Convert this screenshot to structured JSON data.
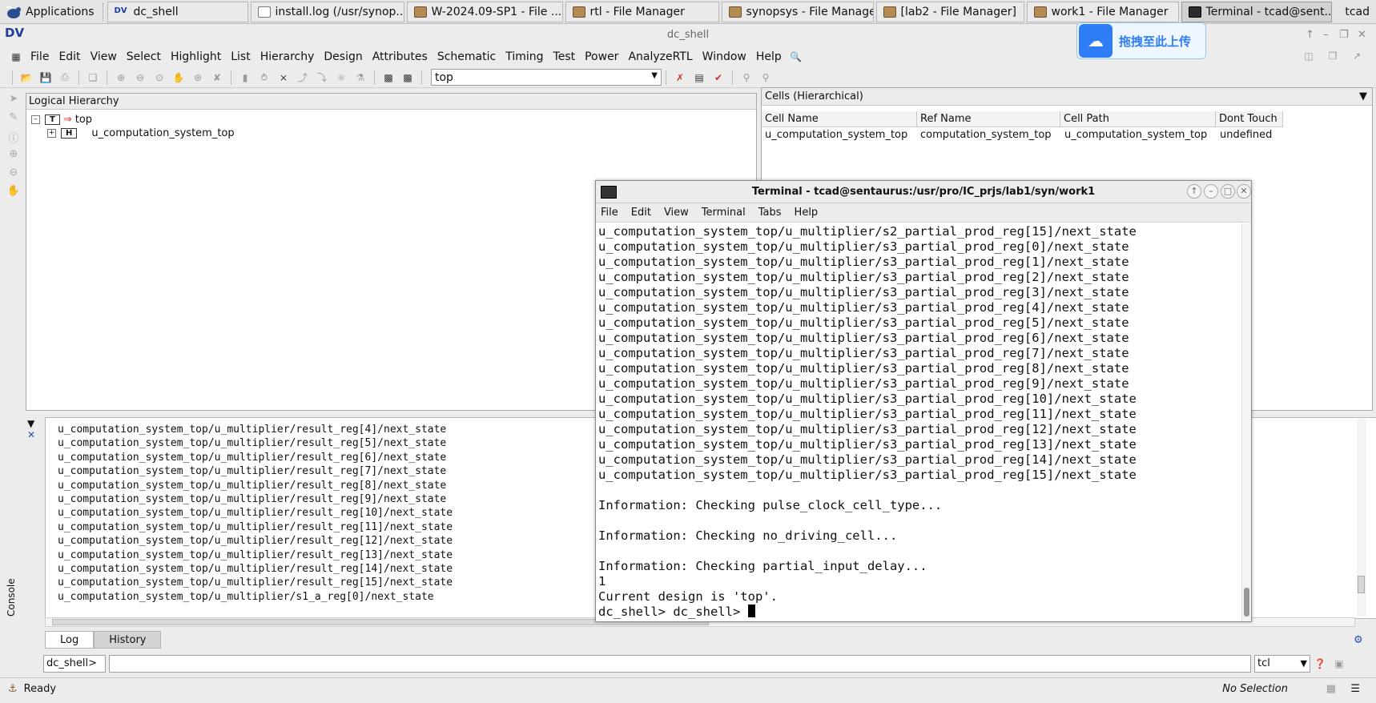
{
  "taskbar": {
    "applications_label": "Applications",
    "tasks": [
      {
        "label": "dc_shell",
        "icon": "dv-icon"
      },
      {
        "label": "install.log (/usr/synop...",
        "icon": "text-editor-icon"
      },
      {
        "label": "W-2024.09-SP1 - File ...",
        "icon": "folder-icon"
      },
      {
        "label": "rtl - File Manager",
        "icon": "folder-icon"
      },
      {
        "label": "synopsys - File Manager",
        "icon": "folder-icon"
      },
      {
        "label": "[lab2 - File Manager]",
        "icon": "folder-icon"
      },
      {
        "label": "work1 - File Manager",
        "icon": "folder-icon"
      },
      {
        "label": "Terminal - tcad@sent...",
        "icon": "terminal-icon"
      }
    ],
    "user": "tcad"
  },
  "app": {
    "logo": "DV",
    "title": "dc_shell"
  },
  "menu": [
    {
      "label": "File",
      "u": "F"
    },
    {
      "label": "Edit",
      "u": "E"
    },
    {
      "label": "View",
      "u": "V"
    },
    {
      "label": "Select",
      "u": "S"
    },
    {
      "label": "Highlight",
      "u": "H"
    },
    {
      "label": "List",
      "u": "L"
    },
    {
      "label": "Hierarchy",
      "u": "H"
    },
    {
      "label": "Design",
      "u": "D"
    },
    {
      "label": "Attributes",
      "u": "A"
    },
    {
      "label": "Schematic",
      "u": "S"
    },
    {
      "label": "Timing",
      "u": "T"
    },
    {
      "label": "Test",
      "u": "T"
    },
    {
      "label": "Power",
      "u": "P"
    },
    {
      "label": "AnalyzeRTL",
      "u": ""
    },
    {
      "label": "Window",
      "u": "W"
    },
    {
      "label": "Help",
      "u": "H"
    }
  ],
  "toolbar": {
    "design_select_value": "top"
  },
  "hierarchy": {
    "title": "Logical Hierarchy",
    "root": {
      "tag": "T",
      "label": "top"
    },
    "child": {
      "tag": "H",
      "label": "u_computation_system_top"
    }
  },
  "cells": {
    "title": "Cells (Hierarchical)",
    "columns": [
      "Cell Name",
      "Ref Name",
      "Cell Path",
      "Dont Touch"
    ],
    "rows": [
      [
        "u_computation_system_top",
        "computation_system_top",
        "u_computation_system_top",
        "undefined"
      ]
    ]
  },
  "console": {
    "log_lines": [
      "u_computation_system_top/u_multiplier/result_reg[4]/next_state",
      "u_computation_system_top/u_multiplier/result_reg[5]/next_state",
      "u_computation_system_top/u_multiplier/result_reg[6]/next_state",
      "u_computation_system_top/u_multiplier/result_reg[7]/next_state",
      "u_computation_system_top/u_multiplier/result_reg[8]/next_state",
      "u_computation_system_top/u_multiplier/result_reg[9]/next_state",
      "u_computation_system_top/u_multiplier/result_reg[10]/next_state",
      "u_computation_system_top/u_multiplier/result_reg[11]/next_state",
      "u_computation_system_top/u_multiplier/result_reg[12]/next_state",
      "u_computation_system_top/u_multiplier/result_reg[13]/next_state",
      "u_computation_system_top/u_multiplier/result_reg[14]/next_state",
      "u_computation_system_top/u_multiplier/result_reg[15]/next_state",
      "u_computation_system_top/u_multiplier/s1_a_reg[0]/next_state"
    ],
    "side_label": "Console",
    "tabs": [
      "Log",
      "History"
    ],
    "prompt": "dc_shell>",
    "lang": "tcl"
  },
  "status": {
    "left": "Ready",
    "right": "No Selection"
  },
  "baidu": {
    "text": "拖拽至此上传"
  },
  "terminal": {
    "title": "Terminal - tcad@sentaurus:/usr/pro/IC_prjs/lab1/syn/work1",
    "menu": [
      "File",
      "Edit",
      "View",
      "Terminal",
      "Tabs",
      "Help"
    ],
    "lines": [
      "u_computation_system_top/u_multiplier/s2_partial_prod_reg[15]/next_state",
      "u_computation_system_top/u_multiplier/s3_partial_prod_reg[0]/next_state",
      "u_computation_system_top/u_multiplier/s3_partial_prod_reg[1]/next_state",
      "u_computation_system_top/u_multiplier/s3_partial_prod_reg[2]/next_state",
      "u_computation_system_top/u_multiplier/s3_partial_prod_reg[3]/next_state",
      "u_computation_system_top/u_multiplier/s3_partial_prod_reg[4]/next_state",
      "u_computation_system_top/u_multiplier/s3_partial_prod_reg[5]/next_state",
      "u_computation_system_top/u_multiplier/s3_partial_prod_reg[6]/next_state",
      "u_computation_system_top/u_multiplier/s3_partial_prod_reg[7]/next_state",
      "u_computation_system_top/u_multiplier/s3_partial_prod_reg[8]/next_state",
      "u_computation_system_top/u_multiplier/s3_partial_prod_reg[9]/next_state",
      "u_computation_system_top/u_multiplier/s3_partial_prod_reg[10]/next_state",
      "u_computation_system_top/u_multiplier/s3_partial_prod_reg[11]/next_state",
      "u_computation_system_top/u_multiplier/s3_partial_prod_reg[12]/next_state",
      "u_computation_system_top/u_multiplier/s3_partial_prod_reg[13]/next_state",
      "u_computation_system_top/u_multiplier/s3_partial_prod_reg[14]/next_state",
      "u_computation_system_top/u_multiplier/s3_partial_prod_reg[15]/next_state",
      "",
      "Information: Checking pulse_clock_cell_type...",
      "",
      "Information: Checking no_driving_cell...",
      "",
      "Information: Checking partial_input_delay...",
      "1",
      "Current design is 'top'.",
      "dc_shell> dc_shell> "
    ]
  }
}
